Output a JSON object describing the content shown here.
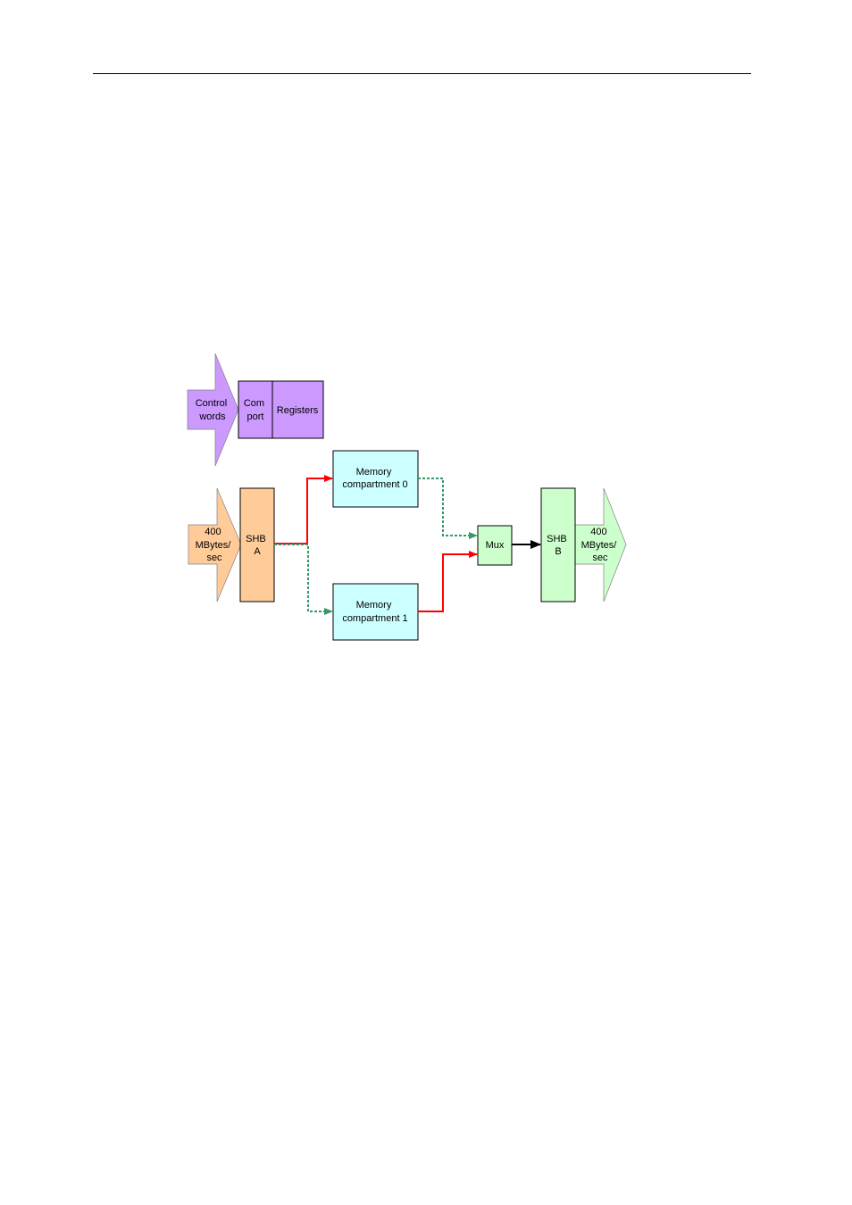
{
  "page": {
    "header_rule": true
  },
  "diagram": {
    "control_arrow": {
      "lines": [
        "Control",
        "words"
      ],
      "color": "#cc99ff"
    },
    "com_port": {
      "lines": [
        "Com",
        "port"
      ],
      "color": "#cc99ff"
    },
    "registers": {
      "lines": [
        "Registers"
      ],
      "color": "#cc99ff"
    },
    "input_arrow": {
      "lines": [
        "400",
        "MBytes/",
        "sec"
      ],
      "color": "#ffcc99"
    },
    "shb_a": {
      "lines": [
        "SHB",
        "A"
      ],
      "color": "#ffcc99"
    },
    "memory0": {
      "lines": [
        "Memory",
        "compartment 0"
      ],
      "color": "#ccffff"
    },
    "memory1": {
      "lines": [
        "Memory",
        "compartment 1"
      ],
      "color": "#ccffff"
    },
    "mux": {
      "lines": [
        "Mux"
      ],
      "color": "#ccffcc"
    },
    "shb_b": {
      "lines": [
        "SHB",
        "B"
      ],
      "color": "#ccffcc"
    },
    "output_arrow": {
      "lines": [
        "400",
        "MBytes/",
        "sec"
      ],
      "color": "#ccffcc"
    },
    "connector_colors": {
      "active": "#ff0000",
      "inactive": "#339966",
      "output": "#000000"
    }
  }
}
